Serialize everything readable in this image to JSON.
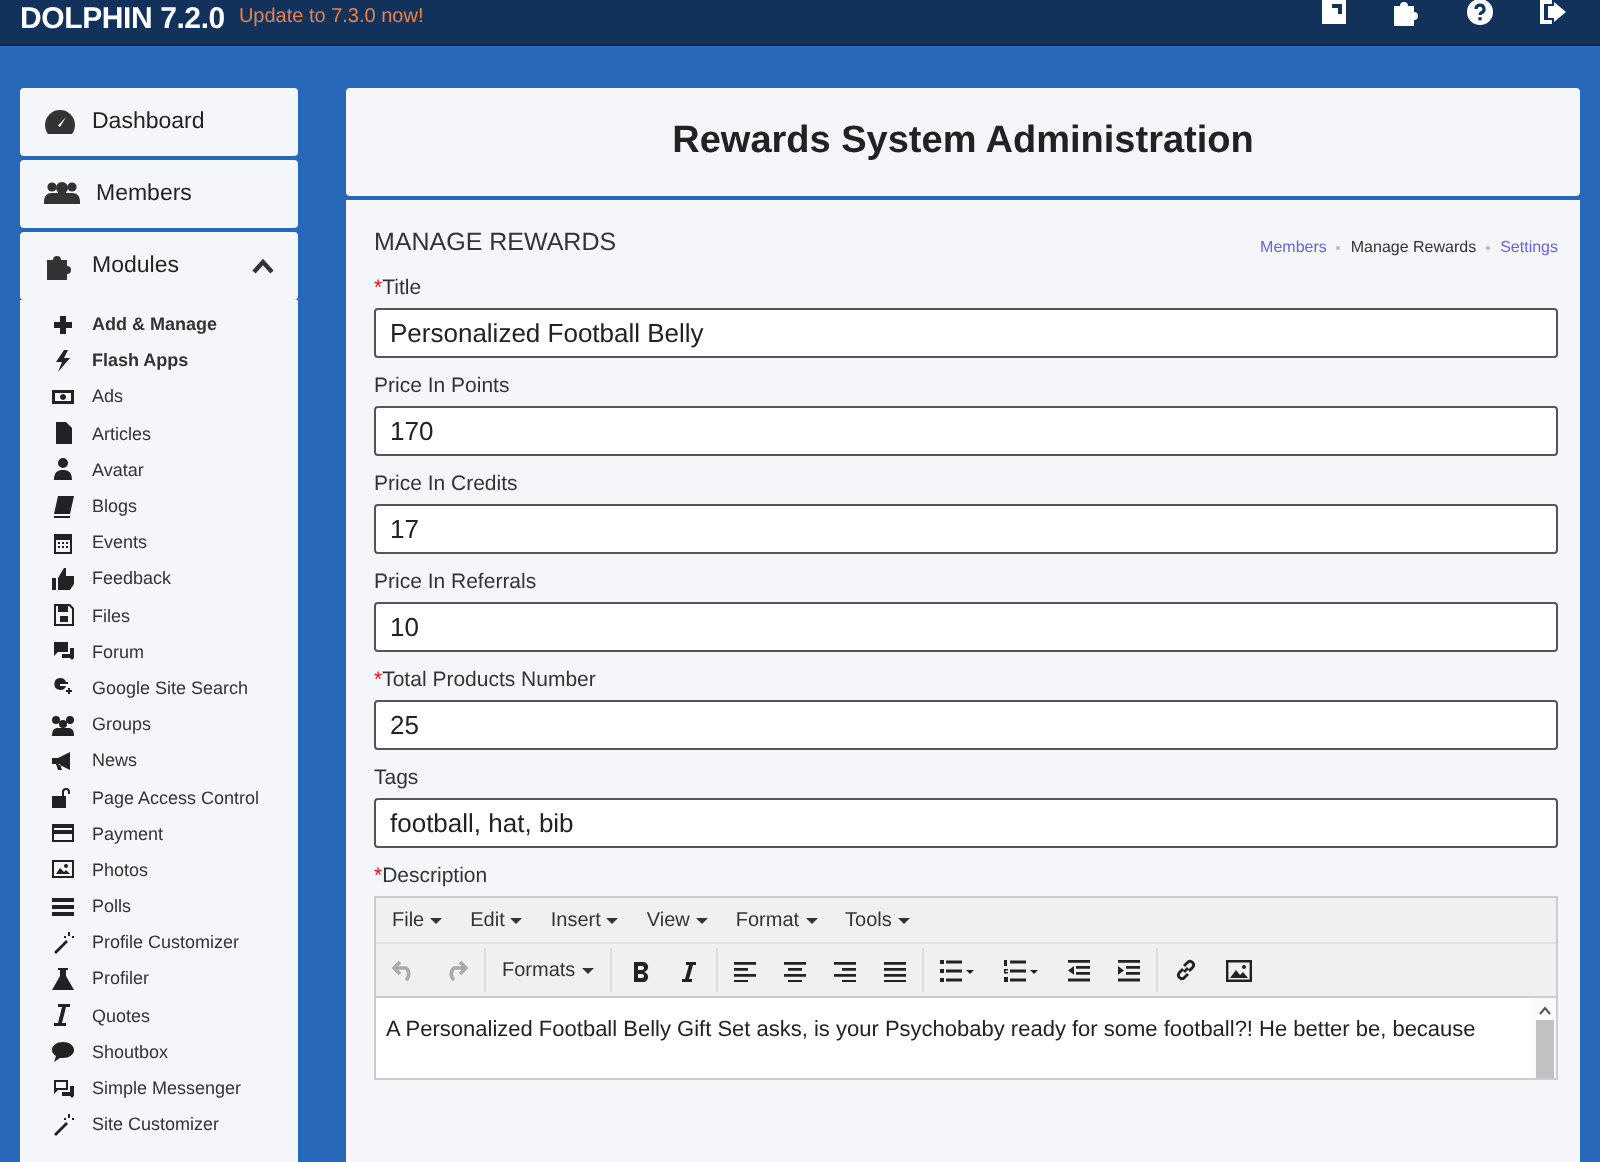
{
  "topbar": {
    "logo": "DOLPHIN 7.2.0",
    "update_link": "Update to 7.3.0 now!"
  },
  "sidebar": {
    "items": [
      {
        "label": "Dashboard",
        "expanded": false
      },
      {
        "label": "Members",
        "expanded": false
      },
      {
        "label": "Modules",
        "expanded": true
      }
    ],
    "modules": [
      {
        "label": "Add & Manage",
        "kind": "action"
      },
      {
        "label": "Flash Apps",
        "kind": "action"
      },
      {
        "label": "Ads",
        "kind": "module"
      },
      {
        "label": "Articles",
        "kind": "module"
      },
      {
        "label": "Avatar",
        "kind": "module"
      },
      {
        "label": "Blogs",
        "kind": "module"
      },
      {
        "label": "Events",
        "kind": "module"
      },
      {
        "label": "Feedback",
        "kind": "module"
      },
      {
        "label": "Files",
        "kind": "module"
      },
      {
        "label": "Forum",
        "kind": "module"
      },
      {
        "label": "Google Site Search",
        "kind": "module"
      },
      {
        "label": "Groups",
        "kind": "module"
      },
      {
        "label": "News",
        "kind": "module"
      },
      {
        "label": "Page Access Control",
        "kind": "module"
      },
      {
        "label": "Payment",
        "kind": "module"
      },
      {
        "label": "Photos",
        "kind": "module"
      },
      {
        "label": "Polls",
        "kind": "module"
      },
      {
        "label": "Profile Customizer",
        "kind": "module"
      },
      {
        "label": "Profiler",
        "kind": "module"
      },
      {
        "label": "Quotes",
        "kind": "module"
      },
      {
        "label": "Shoutbox",
        "kind": "module"
      },
      {
        "label": "Simple Messenger",
        "kind": "module"
      },
      {
        "label": "Site Customizer",
        "kind": "module"
      }
    ]
  },
  "required_mark": "*",
  "page_title": "Rewards System Administration",
  "section": {
    "title": "MANAGE REWARDS",
    "tabs": [
      {
        "label": "Members",
        "selected": false
      },
      {
        "label": "Manage Rewards",
        "selected": true
      },
      {
        "label": "Settings",
        "selected": false
      }
    ]
  },
  "fields": [
    {
      "label": "Title",
      "required": true,
      "value": "Personalized Football Belly"
    },
    {
      "label": "Price In Points",
      "required": false,
      "value": "170"
    },
    {
      "label": "Price In Credits",
      "required": false,
      "value": "17"
    },
    {
      "label": "Price In Referrals",
      "required": false,
      "value": "10"
    },
    {
      "label": "Total Products Number",
      "required": true,
      "value": "25"
    },
    {
      "label": "Tags",
      "required": false,
      "value": "football, hat, bib"
    }
  ],
  "description": {
    "label": "Description",
    "required": true,
    "menus": [
      "File",
      "Edit",
      "Insert",
      "View",
      "Format",
      "Tools"
    ],
    "formats_label": "Formats",
    "toolbar": [
      {
        "kind": "undo",
        "disabled": true
      },
      {
        "kind": "redo",
        "disabled": true
      }
    ],
    "text": "A Personalized Football Belly Gift Set asks, is your Psychobaby ready for some football?! He better be, because"
  }
}
